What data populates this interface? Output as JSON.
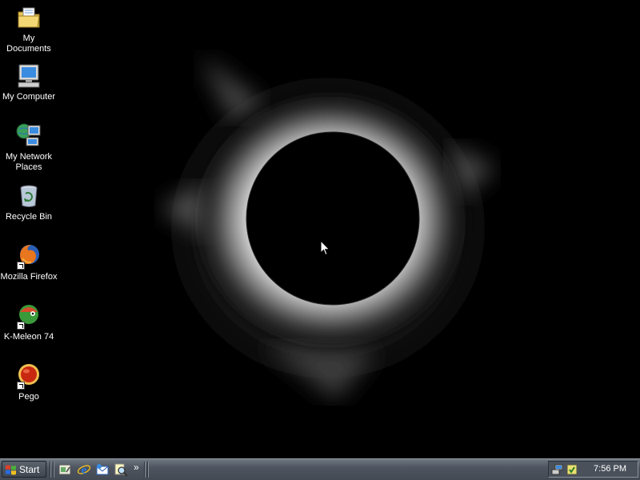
{
  "desktop": {
    "icons": [
      {
        "label": "My Documents",
        "icon": "folder-documents-icon"
      },
      {
        "label": "My Computer",
        "icon": "computer-icon"
      },
      {
        "label": "My Network Places",
        "icon": "network-places-icon"
      },
      {
        "label": "Recycle Bin",
        "icon": "recycle-bin-icon"
      },
      {
        "label": "Mozilla Firefox",
        "icon": "firefox-icon",
        "shortcut": true
      },
      {
        "label": "K-Meleon 74",
        "icon": "k-meleon-icon",
        "shortcut": true
      },
      {
        "label": "Pego",
        "icon": "pego-icon",
        "shortcut": true
      }
    ],
    "wallpaper": "solar-eclipse"
  },
  "taskbar": {
    "start_label": "Start",
    "quick_launch": [
      "show-desktop-icon",
      "internet-explorer-icon",
      "outlook-express-icon",
      "search-icon"
    ],
    "chevron": "»",
    "tray_icons": [
      "network-tray-icon",
      "security-tray-icon"
    ],
    "clock": "7:56 PM"
  },
  "colors": {
    "taskbar": "#4e5560",
    "desktop_background": "#000000",
    "icon_label": "#ffffff"
  }
}
